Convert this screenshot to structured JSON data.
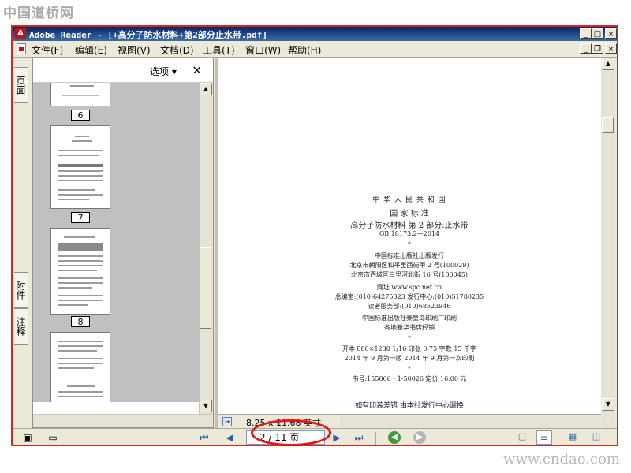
{
  "watermarks": {
    "top": "中国道桥网",
    "bottom": "www.cndao.com"
  },
  "window": {
    "title": "Adobe Reader - [+高分子防水材料+第2部分止水带.pdf]"
  },
  "menu": {
    "items": [
      {
        "label": "文件(F)"
      },
      {
        "label": "编辑(E)"
      },
      {
        "label": "视图(V)"
      },
      {
        "label": "文档(D)"
      },
      {
        "label": "工具(T)"
      },
      {
        "label": "窗口(W)"
      },
      {
        "label": "帮助(H)"
      }
    ]
  },
  "sidebar": {
    "tabs": [
      {
        "label": "页面"
      },
      {
        "label": "附件"
      },
      {
        "label": "注释"
      }
    ],
    "options_label": "选项 ▾",
    "close_label": "×",
    "thumbnails": [
      {
        "page": "6"
      },
      {
        "page": "7"
      },
      {
        "page": "8"
      }
    ]
  },
  "document": {
    "lines": [
      {
        "text": "中 华 人 民 共 和 国"
      },
      {
        "text": "国 家 标 准"
      },
      {
        "text": "高分子防水材料   第 2 部分:止水带"
      },
      {
        "text": "GB 18173.2—2014"
      },
      {
        "text": "*"
      },
      {
        "text": "中国标准出版社出版发行"
      },
      {
        "text": "北京市朝阳区和平里西街甲 2 号(100029)"
      },
      {
        "text": "北京市西城区三里河北街 16 号(100045)"
      },
      {
        "text": "网址  www.spc.net.cn"
      },
      {
        "text": "总编室:(010)64275323   发行中心:(010)51780235"
      },
      {
        "text": "读者服务部:(010)68523946"
      },
      {
        "text": "中国标准出版社秦皇岛印刷厂印刷"
      },
      {
        "text": "各地新华书店经销"
      },
      {
        "text": "*"
      },
      {
        "text": "开本 880×1230  1/16   印张 0.75   字数 15  千字"
      },
      {
        "text": "2014 年 9 月第一版   2014 年 9 月第一次印刷"
      },
      {
        "text": "*"
      },
      {
        "text": "书号:155066・1-50026   定价  16.00  元"
      },
      {
        "text": "如有印装差错   由本社发行中心调换"
      }
    ],
    "page_size": "8.25 x 11.68 英寸"
  },
  "navigation": {
    "page_display": "2 / 11 页",
    "current_page": 2,
    "total_pages": 11
  }
}
